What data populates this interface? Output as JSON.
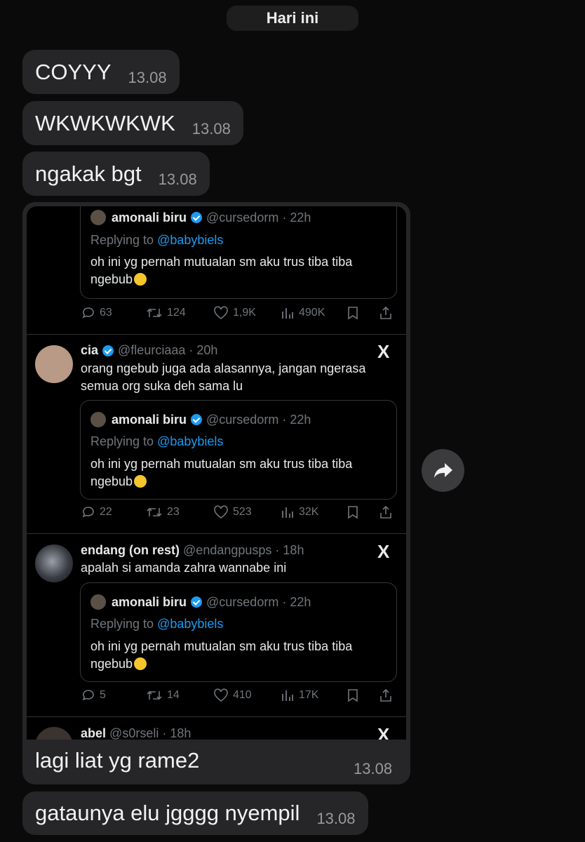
{
  "date_label": "Hari ini",
  "messages_top": [
    {
      "text": "COYYY",
      "time": "13.08"
    },
    {
      "text": "WKWKWKWK",
      "time": "13.08"
    },
    {
      "text": "ngakak bgt",
      "time": "13.08"
    }
  ],
  "media_message": {
    "caption": "lagi liat yg rame2",
    "time": "13.08"
  },
  "messages_bottom": [
    {
      "text": "gataunya elu jgggg nyempil",
      "time": "13.08"
    }
  ],
  "quoted_tweet": {
    "name": "amonali biru",
    "handle": "@cursedorm",
    "time": "· 22h",
    "replying_prefix": "Replying to",
    "replying_to": "@babybiels",
    "text": "oh ini yg pernah mutualan sm aku trus tiba tiba ngebub"
  },
  "tweets": [
    {
      "stats": {
        "replies": "63",
        "retweets": "124",
        "likes": "1,9K",
        "views": "490K"
      }
    },
    {
      "name": "cia",
      "verified": true,
      "handle": "@fleurciaaa",
      "time": "· 20h",
      "text": "orang ngebub juga ada alasannya, jangan ngerasa semua org suka deh sama lu",
      "stats": {
        "replies": "22",
        "retweets": "23",
        "likes": "523",
        "views": "32K"
      }
    },
    {
      "name": "endang (on rest)",
      "verified": false,
      "handle": "@endangpusps",
      "time": "· 18h",
      "text": "apalah si amanda zahra wannabe ini",
      "stats": {
        "replies": "5",
        "retweets": "14",
        "likes": "410",
        "views": "17K"
      }
    },
    {
      "name": "abel",
      "verified": false,
      "handle": "@s0rseli",
      "time": "· 18h"
    }
  ],
  "x_logo": "X",
  "icons": [
    "reply-icon",
    "retweet-icon",
    "like-icon",
    "views-icon",
    "bookmark-icon",
    "share-icon",
    "forward-icon",
    "verified-badge-icon",
    "x-logo-icon"
  ],
  "colors": {
    "background": "#0a0a0a",
    "bubble": "#262628",
    "accent_blue": "#1d9bf0"
  }
}
